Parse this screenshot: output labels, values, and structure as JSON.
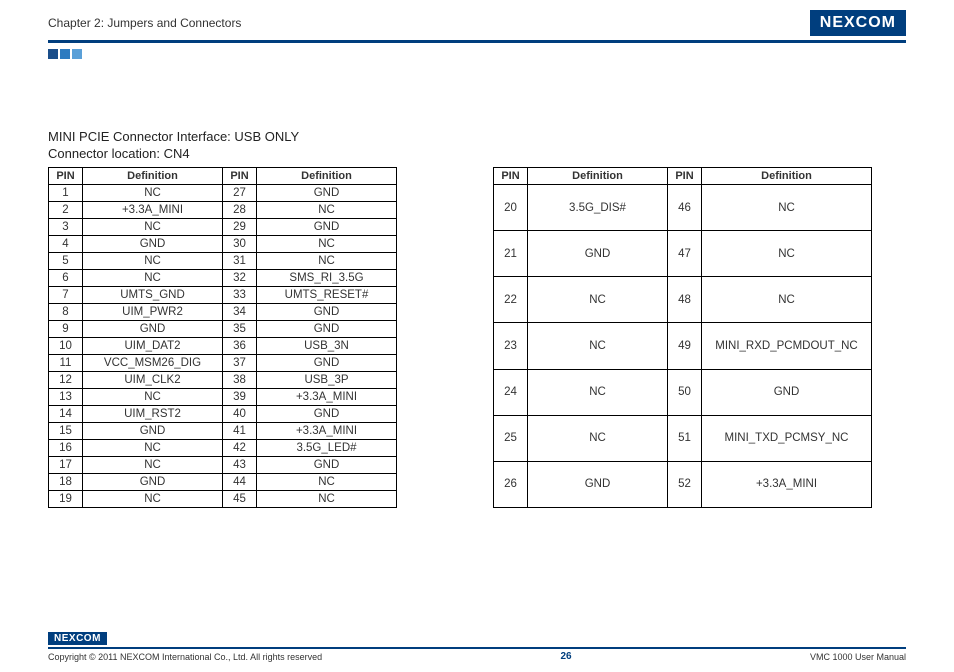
{
  "header": {
    "chapter": "Chapter 2: Jumpers and Connectors",
    "brand": "NEXCOM"
  },
  "section": {
    "title": "MINI PCIE Connector Interface: USB ONLY",
    "location": "Connector location: CN4"
  },
  "table_headers": {
    "pin": "PIN",
    "def": "Definition"
  },
  "table1": [
    {
      "p1": "1",
      "d1": "NC",
      "p2": "27",
      "d2": "GND"
    },
    {
      "p1": "2",
      "d1": "+3.3A_MINI",
      "p2": "28",
      "d2": "NC"
    },
    {
      "p1": "3",
      "d1": "NC",
      "p2": "29",
      "d2": "GND"
    },
    {
      "p1": "4",
      "d1": "GND",
      "p2": "30",
      "d2": "NC"
    },
    {
      "p1": "5",
      "d1": "NC",
      "p2": "31",
      "d2": "NC"
    },
    {
      "p1": "6",
      "d1": "NC",
      "p2": "32",
      "d2": "SMS_RI_3.5G"
    },
    {
      "p1": "7",
      "d1": "UMTS_GND",
      "p2": "33",
      "d2": "UMTS_RESET#"
    },
    {
      "p1": "8",
      "d1": "UIM_PWR2",
      "p2": "34",
      "d2": "GND"
    },
    {
      "p1": "9",
      "d1": "GND",
      "p2": "35",
      "d2": "GND"
    },
    {
      "p1": "10",
      "d1": "UIM_DAT2",
      "p2": "36",
      "d2": "USB_3N"
    },
    {
      "p1": "11",
      "d1": "VCC_MSM26_DIG",
      "p2": "37",
      "d2": "GND"
    },
    {
      "p1": "12",
      "d1": "UIM_CLK2",
      "p2": "38",
      "d2": "USB_3P"
    },
    {
      "p1": "13",
      "d1": "NC",
      "p2": "39",
      "d2": "+3.3A_MINI"
    },
    {
      "p1": "14",
      "d1": "UIM_RST2",
      "p2": "40",
      "d2": "GND"
    },
    {
      "p1": "15",
      "d1": "GND",
      "p2": "41",
      "d2": "+3.3A_MINI"
    },
    {
      "p1": "16",
      "d1": "NC",
      "p2": "42",
      "d2": "3.5G_LED#"
    },
    {
      "p1": "17",
      "d1": "NC",
      "p2": "43",
      "d2": "GND"
    },
    {
      "p1": "18",
      "d1": "GND",
      "p2": "44",
      "d2": "NC"
    },
    {
      "p1": "19",
      "d1": "NC",
      "p2": "45",
      "d2": "NC"
    }
  ],
  "table2": [
    {
      "p1": "20",
      "d1": "3.5G_DIS#",
      "p2": "46",
      "d2": "NC"
    },
    {
      "p1": "21",
      "d1": "GND",
      "p2": "47",
      "d2": "NC"
    },
    {
      "p1": "22",
      "d1": "NC",
      "p2": "48",
      "d2": "NC"
    },
    {
      "p1": "23",
      "d1": "NC",
      "p2": "49",
      "d2": "MINI_RXD_PCMDOUT_NC"
    },
    {
      "p1": "24",
      "d1": "NC",
      "p2": "50",
      "d2": "GND"
    },
    {
      "p1": "25",
      "d1": "NC",
      "p2": "51",
      "d2": "MINI_TXD_PCMSY_NC"
    },
    {
      "p1": "26",
      "d1": "GND",
      "p2": "52",
      "d2": "+3.3A_MINI"
    }
  ],
  "footer": {
    "brand": "NEXCOM",
    "copyright": "Copyright © 2011 NEXCOM International Co., Ltd. All rights reserved",
    "page": "26",
    "manual": "VMC 1000 User Manual"
  }
}
